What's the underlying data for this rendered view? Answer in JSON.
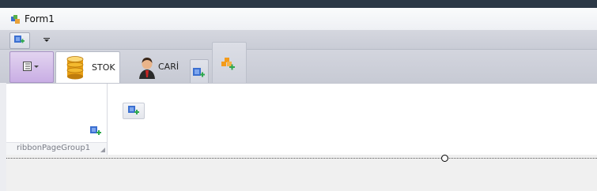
{
  "window": {
    "title": "Form1"
  },
  "quick_access": {
    "add_button_icon": "add-item-icon",
    "customize_icon": "dropdown-arrow-icon"
  },
  "ribbon": {
    "app_button_icon": "application-menu-icon",
    "tabs": [
      {
        "label": "STOK",
        "icon": "database-icon",
        "selected": true
      },
      {
        "label": "CARİ",
        "icon": "user-icon",
        "selected": false
      }
    ],
    "page_group": {
      "caption": "ribbonPageGroup1"
    }
  },
  "colors": {
    "title_bar": "#2b3846",
    "app_button": "#c9aee4",
    "ribbon_bg": "#ecedf1",
    "add_icon_blue": "#3b6fd0",
    "add_icon_green": "#2fa84f",
    "add_icon_orange": "#f39b1b"
  }
}
